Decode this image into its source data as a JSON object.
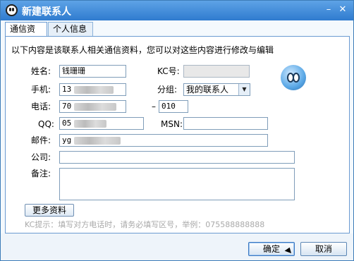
{
  "window": {
    "title": "新建联系人",
    "min_glyph": "–",
    "close_glyph": "✕"
  },
  "tabs": [
    {
      "label": "通信资料",
      "active": true
    },
    {
      "label": "个人信息",
      "active": false
    }
  ],
  "description": "以下内容是该联系人相关通信资料，您可以对这些内容进行修改与编辑",
  "fields": {
    "name": {
      "label": "姓名:",
      "value": "钱珊珊"
    },
    "kc": {
      "label": "KC号:",
      "value": ""
    },
    "mobile": {
      "label": "手机:",
      "value": "13"
    },
    "group": {
      "label": "分组:",
      "value": "我的联系人",
      "arrow": "▼"
    },
    "phone": {
      "label": "电话:",
      "value": "70",
      "separator": "–",
      "area_code": "010"
    },
    "qq": {
      "label": "QQ:",
      "value": "05"
    },
    "msn": {
      "label": "MSN:",
      "value": ""
    },
    "email": {
      "label": "邮件:",
      "value": "yg"
    },
    "company": {
      "label": "公司:",
      "value": ""
    },
    "notes": {
      "label": "备注:",
      "value": ""
    }
  },
  "more_button": "更多资料",
  "hint": "KC提示：填写对方电话时，请务必填写区号，举例：075588888888",
  "buttons": {
    "ok": "确定",
    "cancel": "取消"
  },
  "icons": {
    "app": "kc-logo-icon",
    "avatar": "contact-avatar-icon"
  }
}
